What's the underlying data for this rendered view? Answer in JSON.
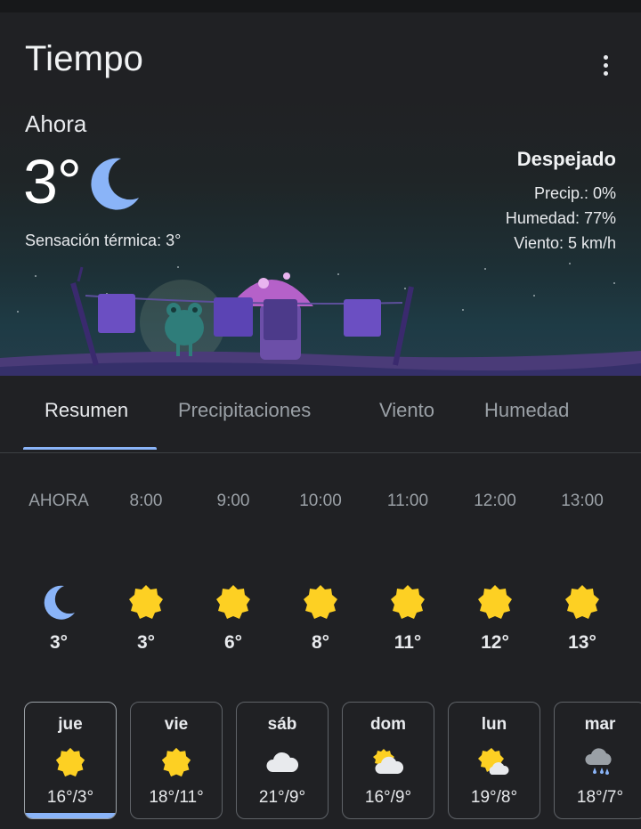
{
  "app": {
    "title": "Tiempo"
  },
  "current": {
    "label": "Ahora",
    "temp": "3°",
    "icon": "moon-icon",
    "feels_like": "Sensación térmica: 3°",
    "condition": "Despejado",
    "precip": "Precip.: 0%",
    "humidity": "Humedad: 77%",
    "wind": "Viento: 5 km/h"
  },
  "tabs": [
    {
      "label": "Resumen",
      "selected": true
    },
    {
      "label": "Precipitaciones",
      "selected": false
    },
    {
      "label": "Viento",
      "selected": false
    },
    {
      "label": "Humedad",
      "selected": false
    }
  ],
  "hourly": [
    {
      "time": "AHORA",
      "icon": "moon-icon",
      "temp": "3°"
    },
    {
      "time": "8:00",
      "icon": "sun-icon",
      "temp": "3°"
    },
    {
      "time": "9:00",
      "icon": "sun-icon",
      "temp": "6°"
    },
    {
      "time": "10:00",
      "icon": "sun-icon",
      "temp": "8°"
    },
    {
      "time": "11:00",
      "icon": "sun-icon",
      "temp": "11°"
    },
    {
      "time": "12:00",
      "icon": "sun-icon",
      "temp": "12°"
    },
    {
      "time": "13:00",
      "icon": "sun-icon",
      "temp": "13°"
    }
  ],
  "daily": [
    {
      "day": "jue",
      "icon": "sun-icon",
      "temps": "16°/3°",
      "selected": true
    },
    {
      "day": "vie",
      "icon": "sun-icon",
      "temps": "18°/11°",
      "selected": false
    },
    {
      "day": "sáb",
      "icon": "cloud-icon",
      "temps": "21°/9°",
      "selected": false
    },
    {
      "day": "dom",
      "icon": "partly-cloudy-icon",
      "temps": "16°/9°",
      "selected": false
    },
    {
      "day": "lun",
      "icon": "partly-cloudy-icon",
      "temps": "19°/8°",
      "selected": false
    },
    {
      "day": "mar",
      "icon": "rain-icon",
      "temps": "18°/7°",
      "selected": false
    }
  ],
  "colors": {
    "background": "#202124",
    "accent": "#8ab4f8",
    "sun": "#fdd023",
    "moon": "#8ab4f8"
  }
}
